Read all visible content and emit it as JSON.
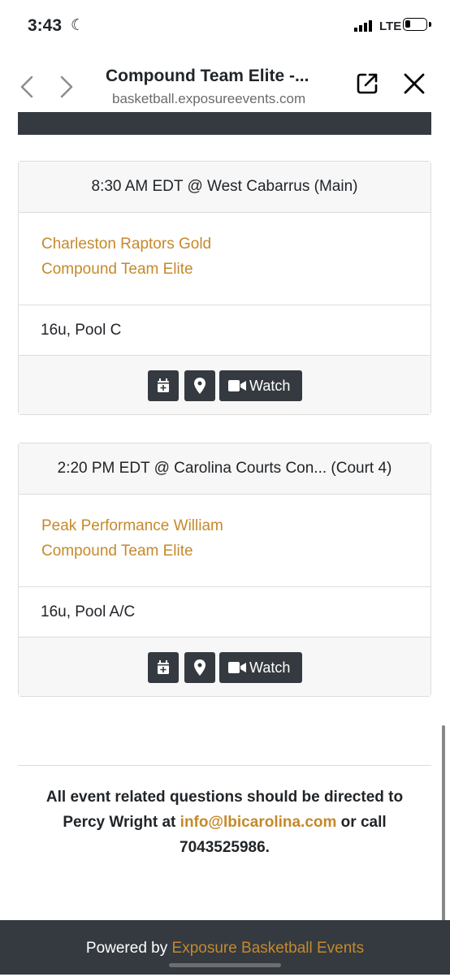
{
  "status": {
    "time": "3:43",
    "network": "LTE",
    "battery_level": 0.25
  },
  "browser": {
    "title": "Compound Team Elite -...",
    "url": "basketball.exposureevents.com"
  },
  "games": [
    {
      "time_venue": "8:30 AM EDT @ West Cabarrus (Main)",
      "team1": "Charleston Raptors Gold",
      "team2": "Compound Team Elite",
      "division": "16u, Pool C",
      "watch_label": "Watch"
    },
    {
      "time_venue": "2:20 PM EDT @ Carolina Courts Con... (Court 4)",
      "team1": "Peak Performance William",
      "team2": "Compound Team Elite",
      "division": "16u, Pool A/C",
      "watch_label": "Watch"
    }
  ],
  "contact": {
    "line1": "All event related questions should be directed to",
    "prefix": "Percy Wright at ",
    "email": "info@lbicarolina.com",
    "suffix": " or call",
    "phone": "7043525986."
  },
  "footer": {
    "powered_prefix": "Powered by ",
    "powered_link": "Exposure Basketball Events"
  },
  "colors": {
    "accent": "#c5892b",
    "dark": "#343a40",
    "card_bg": "#f7f7f7"
  }
}
